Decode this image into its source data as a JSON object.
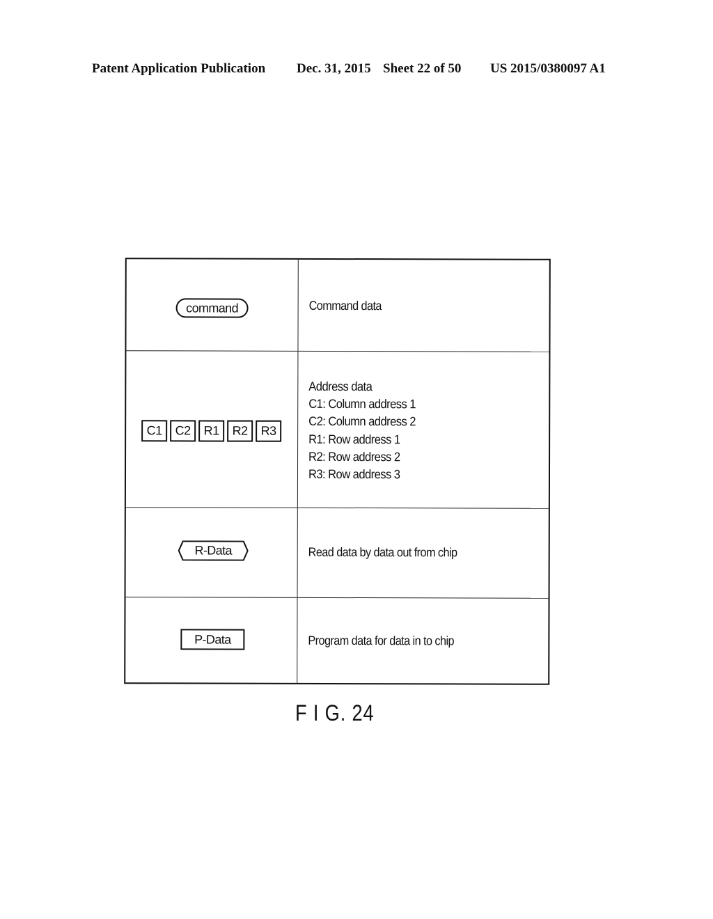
{
  "header": {
    "publication": "Patent Application Publication",
    "date": "Dec. 31, 2015",
    "sheet": "Sheet 22 of 50",
    "number": "US 2015/0380097 A1"
  },
  "table": {
    "rows": [
      {
        "symbol": "command",
        "symbol_shape": "rounded-pill",
        "description": "Command data"
      },
      {
        "symbol_boxes": [
          "C1",
          "C2",
          "R1",
          "R2",
          "R3"
        ],
        "symbol_shape": "rectangles",
        "description_lines": [
          "Address data",
          "C1: Column address 1",
          "C2: Column address 2",
          "R1: Row address 1",
          "R2: Row address 2",
          "R3: Row address 3"
        ]
      },
      {
        "symbol": "R-Data",
        "symbol_shape": "hexagon",
        "description": "Read data by data out from chip"
      },
      {
        "symbol": "P-Data",
        "symbol_shape": "rectangle",
        "description": "Program data for data in to chip"
      }
    ]
  },
  "figure_label": "F I G. 24"
}
